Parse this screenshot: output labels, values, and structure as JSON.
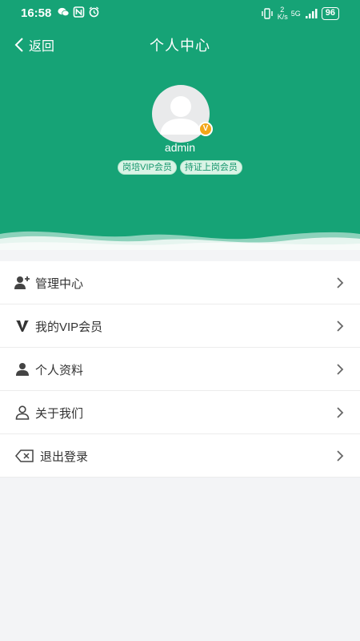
{
  "status_bar": {
    "time": "16:58",
    "network_speed": "2 K/s",
    "network_type": "5G",
    "battery": "96",
    "left_icons": [
      "wechat-icon",
      "nfc-icon",
      "alarm-icon"
    ],
    "right_icons": [
      "vibrate-icon",
      "signal-icon",
      "battery-icon"
    ]
  },
  "nav": {
    "back_label": "返回",
    "title": "个人中心"
  },
  "profile": {
    "username": "admin",
    "vip_badge_letter": "V",
    "badges": [
      "岗培VIP会员",
      "持证上岗会员"
    ]
  },
  "menu": {
    "items": [
      {
        "label": "管理中心",
        "icon": "user-plus-icon"
      },
      {
        "label": "我的VIP会员",
        "icon": "vip-v-icon"
      },
      {
        "label": "个人资料",
        "icon": "person-icon"
      },
      {
        "label": "关于我们",
        "icon": "person-outline-icon"
      },
      {
        "label": "退出登录",
        "icon": "delete-left-icon"
      }
    ]
  },
  "colors": {
    "header_green": "#16a376",
    "badge_bg": "#d9f4e6",
    "badge_text": "#15966c",
    "vip_orange": "#f2a619",
    "page_bg": "#f3f4f6"
  }
}
